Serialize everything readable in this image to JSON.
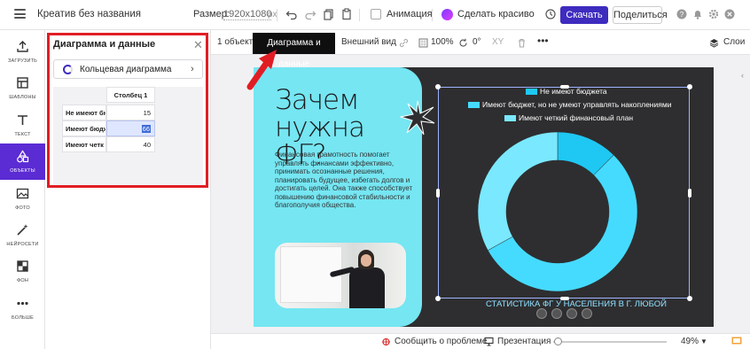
{
  "topbar": {
    "title": "Креатив без названия",
    "size_label": "Размер:",
    "size_value": "1920x1080",
    "size_unit": "px",
    "animation_label": "Анимация",
    "magic_label": "Сделать красиво",
    "download_label": "Скачать",
    "share_label": "Поделиться"
  },
  "sidebar": {
    "items": [
      {
        "label": "ЗАГРУЗИТЬ",
        "icon": "upload-icon"
      },
      {
        "label": "ШАБЛОНЫ",
        "icon": "templates-icon"
      },
      {
        "label": "ТЕКСТ",
        "icon": "text-icon"
      },
      {
        "label": "ОБЪЕКТЫ",
        "icon": "objects-icon",
        "active": true
      },
      {
        "label": "ФОТО",
        "icon": "photo-icon"
      },
      {
        "label": "НЕЙРОСЕТИ",
        "icon": "ai-wand-icon"
      },
      {
        "label": "ФОН",
        "icon": "background-icon"
      },
      {
        "label": "БОЛЬШЕ",
        "icon": "more-icon"
      }
    ]
  },
  "panel": {
    "title": "Диаграмма и данные",
    "chart_type": "Кольцевая диаграмма",
    "column_header": "Столбец 1",
    "rows": [
      {
        "label": "Не имеют бюд",
        "value": "15"
      },
      {
        "label": "Имеют бюдж",
        "value": "66",
        "selected": true
      },
      {
        "label": "Имеют четк",
        "value": "40"
      }
    ]
  },
  "context_bar": {
    "object_count": "1 объект",
    "active_tab": "Диаграмма и данные",
    "appearance": "Внешний вид",
    "opacity": "100%",
    "rotation": "0°",
    "xy": "XY",
    "layers": "Слои"
  },
  "design": {
    "headline_line1": "Зачем",
    "headline_line2": "нужна ФГ?",
    "body_text": "Финансовая грамотность помогает управлять финансами эффективно, принимать осознанные решения, планировать будущее, избегать долгов и достигать целей. Она также способствует повышению финансовой стабильности и благополучия общества.",
    "chart_caption": "СТАТИСТИКА ФГ У НАСЕЛЕНИЯ В Г. ЛЮБОЙ"
  },
  "chart_data": {
    "type": "pie",
    "subtype": "donut",
    "categories": [
      "Не имеют бюджета",
      "Имеют бюджет, но не умеют управлять накоплениями",
      "Имеют четкий финансовый план"
    ],
    "values": [
      15,
      66,
      40
    ],
    "colors": [
      "#1ec8f2",
      "#45dbff",
      "#7ae8ff"
    ],
    "legend_position": "top",
    "title": "СТАТИСТИКА ФГ У НАСЕЛЕНИЯ В Г. ЛЮБОЙ"
  },
  "bottombar": {
    "report_label": "Сообщить о проблеме",
    "presentation_label": "Презентация",
    "zoom": "49%"
  },
  "colors": {
    "accent": "#3e2cbf",
    "active_sidebar": "#5b2bd3",
    "highlight": "#e11d24",
    "design_bg": "#2e2e30",
    "card": "#75e6f2"
  }
}
